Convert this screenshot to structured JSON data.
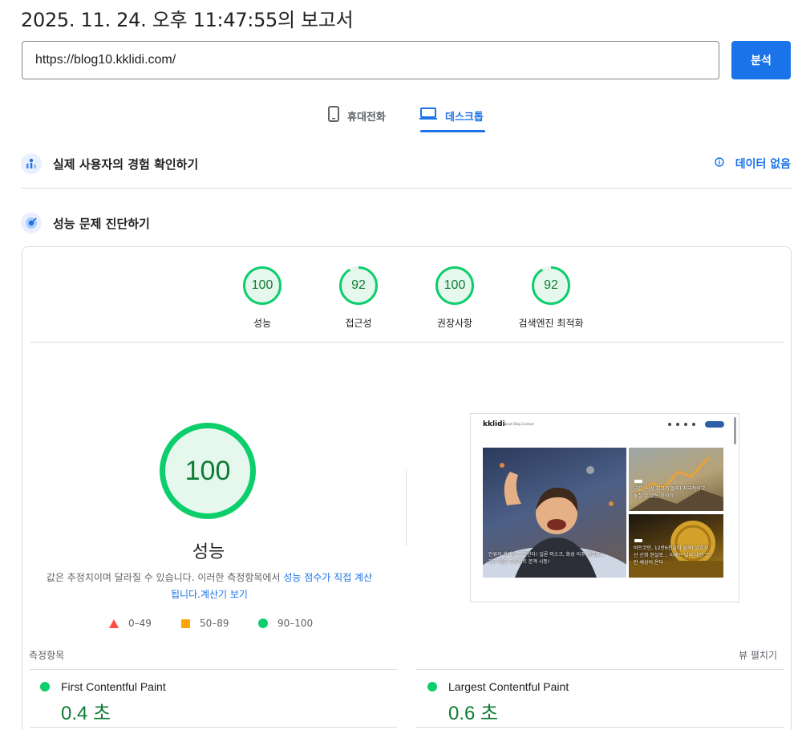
{
  "report_title": "2025. 11. 24. 오후 11:47:55의 보고서",
  "url_input": {
    "value": "https://blog10.kklidi.com/"
  },
  "analyze_button": "분석",
  "tabs": [
    {
      "label": "휴대전화",
      "icon": "phone-icon",
      "active": false
    },
    {
      "label": "데스크톱",
      "icon": "laptop-icon",
      "active": true
    }
  ],
  "field_data": {
    "title": "실제 사용자의 경험 확인하기",
    "status": "데이터 없음",
    "icon": "info-icon"
  },
  "lab_data": {
    "title": "성능 문제 진단하기"
  },
  "categories": [
    {
      "score": "100",
      "label": "성능",
      "fraction": 1.0
    },
    {
      "score": "92",
      "label": "접근성",
      "fraction": 0.92
    },
    {
      "score": "100",
      "label": "권장사항",
      "fraction": 1.0
    },
    {
      "score": "92",
      "label": "검색엔진 최적화",
      "fraction": 0.92
    }
  ],
  "performance": {
    "score": "100",
    "fraction": 1.0,
    "label": "성능",
    "desc_text": "값은 추정치이며 달라질 수 있습니다. 이러한 측정항목에서 ",
    "desc_link1": "성능 점수가 직접 계산됩니다.",
    "desc_link2": "계산기 보기"
  },
  "legend": [
    {
      "range": "0–49",
      "shape": "triangle",
      "color": "#ff4e42"
    },
    {
      "range": "50–89",
      "shape": "square",
      "color": "#ffa400"
    },
    {
      "range": "90–100",
      "shape": "circle",
      "color": "#0cce6b"
    }
  ],
  "screenshot": {
    "logo": "kklidi",
    "nav": "About  Blog  Contact",
    "hero_caption": "인류의 한계에 도전한다! 일론 머스크, 화성 이주 현실로...\n지구 탈출 프로젝트 본격 시동!",
    "tile1_caption": "금값, 사상 최고가 돌파! 지국적이고\n놓칠 수 없는 이야기",
    "tile2_caption": "비트코인, 12만6천달러 돌파! 암호자\n산 신화 현실로... 이제는 달러 대신 코\n인 세상이 온다"
  },
  "metrics_header": {
    "label": "측정항목",
    "expand": "뷰 펼치기"
  },
  "metrics": [
    {
      "name": "First Contentful Paint",
      "value": "0.4 초"
    },
    {
      "name": "Largest Contentful Paint",
      "value": "0.6 초"
    }
  ],
  "colors": {
    "accent": "#1a73e8",
    "pass": "#0cce6b",
    "pass_text": "#0d7c34"
  }
}
